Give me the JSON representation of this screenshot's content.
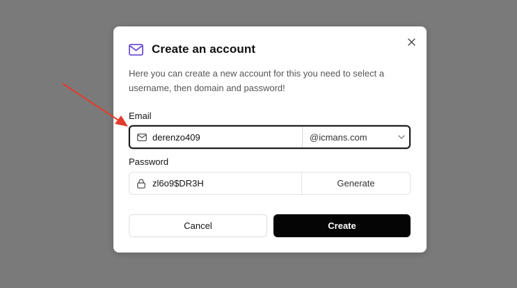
{
  "dialog": {
    "title": "Create an account",
    "title_icon": "mail-icon",
    "description": "Here you can create a new account for this you need to select a username, then domain and password!",
    "close_icon": "close-icon"
  },
  "email": {
    "label": "Email",
    "icon": "mail-icon",
    "value": "derenzo409",
    "domain_selected": "@icmans.com",
    "domain_icon": "chevron-down-icon"
  },
  "password": {
    "label": "Password",
    "icon": "lock-icon",
    "value": "zl6o9$DR3H",
    "generate_label": "Generate"
  },
  "actions": {
    "cancel_label": "Cancel",
    "create_label": "Create"
  },
  "colors": {
    "accent_icon": "#6b4fd8",
    "overlay": "#7a7a7a",
    "annotation_arrow": "#e53b2c",
    "primary_button": "#050505"
  }
}
